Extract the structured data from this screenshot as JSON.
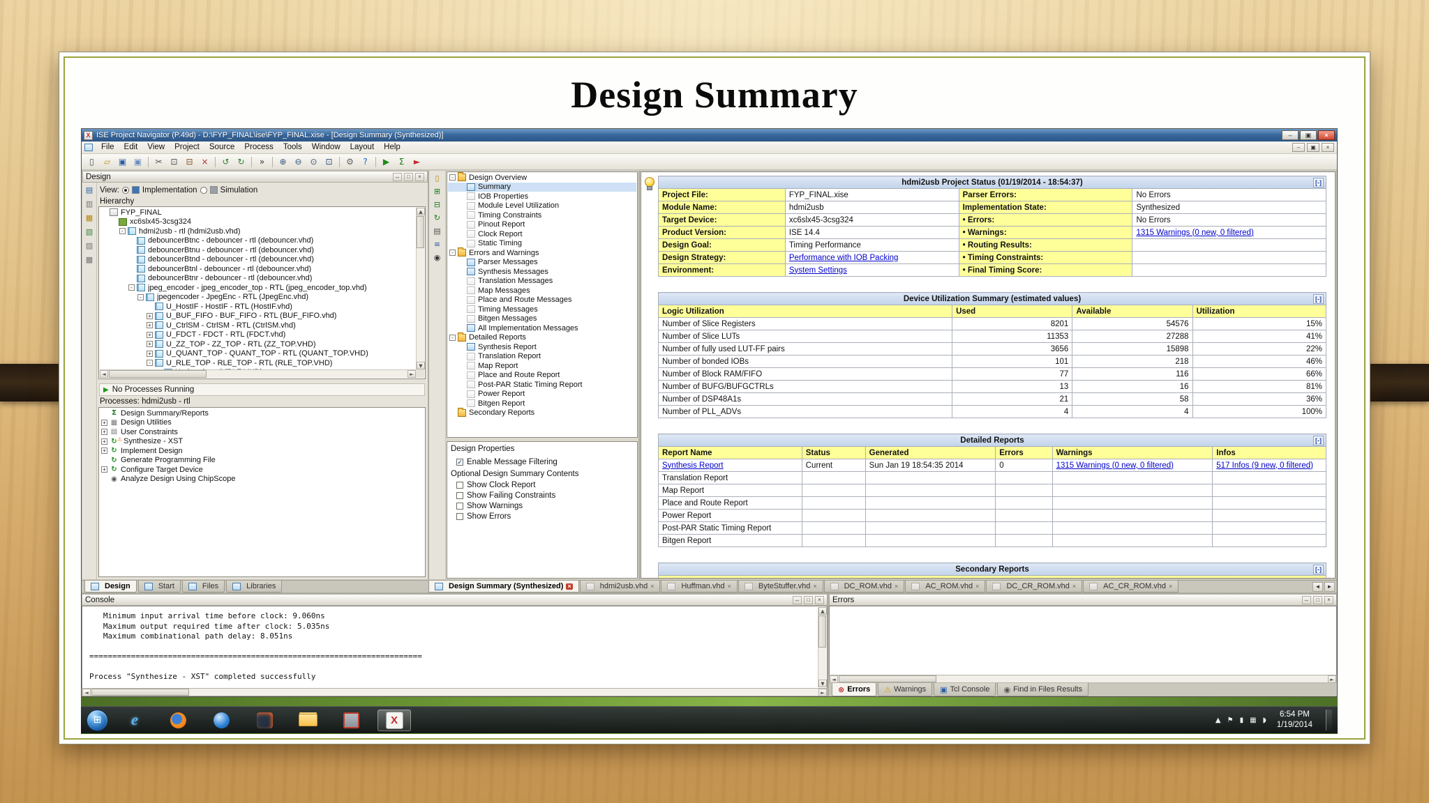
{
  "ui": {
    "minimize_box": "[-]"
  },
  "glyphs": {
    "check": "✓",
    "warning": "⚠",
    "play": "▶",
    "left": "◄",
    "right": "►",
    "up": "▲",
    "down": "▼",
    "close": "×",
    "win_flag": "⊞"
  },
  "slide": {
    "title": "Design Summary"
  },
  "titlebar": {
    "title": "ISE Project Navigator (P.49d) - D:\\FYP_FINAL\\ise\\FYP_FINAL.xise - [Design Summary (Synthesized)]",
    "controls": [
      {
        "name": "minimize-button",
        "glyph": "–"
      },
      {
        "name": "maximize-button",
        "glyph": "▣"
      },
      {
        "name": "close-button",
        "glyph": "×",
        "accent": true
      }
    ]
  },
  "menubar": {
    "items": [
      "File",
      "Edit",
      "View",
      "Project",
      "Source",
      "Process",
      "Tools",
      "Window",
      "Layout",
      "Help"
    ],
    "mdi_controls": [
      {
        "name": "mdi-minimize-button",
        "glyph": "–"
      },
      {
        "name": "mdi-restore-button",
        "glyph": "▣"
      },
      {
        "name": "mdi-close-button",
        "glyph": "×"
      }
    ]
  },
  "panel_controls": [
    {
      "name": "panel-float-button",
      "glyph": "↔"
    },
    {
      "name": "panel-restore-button",
      "glyph": "□"
    },
    {
      "name": "panel-close-button",
      "glyph": "×"
    }
  ],
  "toolbar": {
    "items": [
      {
        "name": "new-file-icon",
        "glyph": "▯",
        "color": "#4a5560"
      },
      {
        "name": "open-folder-icon",
        "glyph": "▱",
        "color": "#c09020"
      },
      {
        "name": "save-icon",
        "glyph": "▣",
        "color": "#2b5fa8"
      },
      {
        "name": "save-all-icon",
        "glyph": "▣",
        "color": "#6b8fc0"
      },
      {
        "sep": true
      },
      {
        "name": "cut-icon",
        "glyph": "✂",
        "color": "#555555"
      },
      {
        "name": "copy-icon",
        "glyph": "⊡",
        "color": "#555555"
      },
      {
        "name": "paste-icon",
        "glyph": "⊟",
        "color": "#8b5a2b"
      },
      {
        "name": "delete-icon",
        "glyph": "×",
        "color": "#b03030"
      },
      {
        "sep": true
      },
      {
        "name": "undo-icon",
        "glyph": "↺",
        "color": "#2e7d32"
      },
      {
        "name": "redo-icon",
        "glyph": "↻",
        "color": "#2e7d32"
      },
      {
        "sep": true
      },
      {
        "name": "overflow-icon",
        "glyph": "»",
        "color": "#333333"
      },
      {
        "sep": true
      },
      {
        "name": "zoom-in-icon",
        "glyph": "⊕",
        "color": "#30557f"
      },
      {
        "name": "zoom-out-icon",
        "glyph": "⊖",
        "color": "#30557f"
      },
      {
        "name": "zoom-full-icon",
        "glyph": "⊙",
        "color": "#30557f"
      },
      {
        "name": "zoom-region-icon",
        "glyph": "⊡",
        "color": "#30557f"
      },
      {
        "sep": true
      },
      {
        "name": "settings-icon",
        "glyph": "⚙",
        "color": "#666666"
      },
      {
        "name": "help-icon",
        "glyph": "?",
        "color": "#1565c0"
      },
      {
        "sep": true
      },
      {
        "name": "run-icon",
        "glyph": "▶",
        "color": "#1d8a1d"
      },
      {
        "name": "sigma-icon",
        "glyph": "Σ",
        "color": "#1d7a1d"
      },
      {
        "name": "launch-icon",
        "glyph": "►",
        "color": "#c62828"
      }
    ]
  },
  "design_panel": {
    "title": "Design",
    "strip_icons": [
      {
        "name": "sources-view-icon",
        "glyph": "▤",
        "color": "#2b5fa8"
      },
      {
        "name": "files-view-icon",
        "glyph": "▥",
        "color": "#777777"
      },
      {
        "name": "libraries-view-icon",
        "glyph": "▦",
        "color": "#b8860b"
      },
      {
        "name": "snapshots-view-icon",
        "glyph": "▧",
        "color": "#448844"
      },
      {
        "name": "console-view-icon",
        "glyph": "▨",
        "color": "#777777"
      },
      {
        "name": "reports-view-icon",
        "glyph": "▩",
        "color": "#777777"
      }
    ],
    "view_label": "View:",
    "views": [
      {
        "label": "Implementation",
        "selected": true,
        "icon_color": "#3a76b5"
      },
      {
        "label": "Simulation",
        "selected": false,
        "icon_color": "#9aa0a6"
      }
    ],
    "hierarchy_label": "Hierarchy",
    "hierarchy": [
      {
        "label": "FYP_FINAL",
        "depth": 0,
        "icon": "project"
      },
      {
        "label": "xc6slx45-3csg324",
        "depth": 1,
        "icon": "chip"
      },
      {
        "label": "hdmi2usb - rtl (hdmi2usb.vhd)",
        "depth": 2,
        "expand": "-",
        "icon": "module"
      },
      {
        "label": "debouncerBtnc - debouncer - rtl (debouncer.vhd)",
        "depth": 3,
        "icon": "module"
      },
      {
        "label": "debouncerBtnu - debouncer - rtl (debouncer.vhd)",
        "depth": 3,
        "icon": "module"
      },
      {
        "label": "debouncerBtnd - debouncer - rtl (debouncer.vhd)",
        "depth": 3,
        "icon": "module"
      },
      {
        "label": "debouncerBtnl - debouncer - rtl (debouncer.vhd)",
        "depth": 3,
        "icon": "module"
      },
      {
        "label": "debouncerBtnr - debouncer - rtl (debouncer.vhd)",
        "depth": 3,
        "icon": "module"
      },
      {
        "label": "jpeg_encoder - jpeg_encoder_top - RTL (jpeg_encoder_top.vhd)",
        "depth": 3,
        "expand": "-",
        "icon": "module"
      },
      {
        "label": "jpegencoder - JpegEnc - RTL (JpegEnc.vhd)",
        "depth": 4,
        "expand": "-",
        "icon": "module"
      },
      {
        "label": "U_HostIF - HostIF - RTL (HostIF.vhd)",
        "depth": 5,
        "icon": "module"
      },
      {
        "label": "U_BUF_FIFO - BUF_FIFO - RTL (BUF_FIFO.vhd)",
        "depth": 5,
        "expand": "+",
        "icon": "module"
      },
      {
        "label": "U_CtrlSM - CtrlSM - RTL (CtrlSM.vhd)",
        "depth": 5,
        "expand": "+",
        "icon": "module"
      },
      {
        "label": "U_FDCT - FDCT - RTL (FDCT.vhd)",
        "depth": 5,
        "expand": "+",
        "icon": "module"
      },
      {
        "label": "U_ZZ_TOP - ZZ_TOP - RTL (ZZ_TOP.VHD)",
        "depth": 5,
        "expand": "+",
        "icon": "module"
      },
      {
        "label": "U_QUANT_TOP - QUANT_TOP - RTL (QUANT_TOP.VHD)",
        "depth": 5,
        "expand": "+",
        "icon": "module"
      },
      {
        "label": "U_RLE_TOP - RLE_TOP - RTL (RLE_TOP.VHD)",
        "depth": 5,
        "expand": "-",
        "icon": "module"
      },
      {
        "label": "U_rle - rle - rtl (RLE.VHD)",
        "depth": 6,
        "icon": "module"
      }
    ],
    "no_processes": "No Processes Running",
    "processes_label": "Processes: hdmi2usb - rtl",
    "processes": [
      {
        "label": "Design Summary/Reports",
        "glyph": "Σ",
        "color": "#1d7a1d"
      },
      {
        "label": "Design Utilities",
        "expand": "+",
        "glyph": "▦",
        "color": "#777777"
      },
      {
        "label": "User Constraints",
        "expand": "+",
        "glyph": "▤",
        "color": "#777777"
      },
      {
        "label": "Synthesize - XST",
        "expand": "+",
        "glyph": "↻",
        "color": "#1d8a1d",
        "warn": true
      },
      {
        "label": "Implement Design",
        "expand": "+",
        "glyph": "↻",
        "color": "#1d8a1d"
      },
      {
        "label": "Generate Programming File",
        "glyph": "↻",
        "color": "#1d8a1d"
      },
      {
        "label": "Configure Target Device",
        "expand": "+",
        "glyph": "↻",
        "color": "#1d8a1d"
      },
      {
        "label": "Analyze Design Using ChipScope",
        "glyph": "◉",
        "color": "#555555"
      }
    ],
    "tabs": [
      {
        "label": "Design",
        "active": true
      },
      {
        "label": "Start"
      },
      {
        "label": "Files"
      },
      {
        "label": "Libraries"
      }
    ]
  },
  "overview_strip": [
    {
      "name": "new-report-icon",
      "glyph": "▯",
      "color": "#b8860b"
    },
    {
      "name": "expand-all-icon",
      "glyph": "⊞",
      "color": "#1d7a1d"
    },
    {
      "name": "collapse-all-icon",
      "glyph": "⊟",
      "color": "#1d7a1d"
    },
    {
      "name": "refresh-icon",
      "glyph": "↻",
      "color": "#1d7a1d"
    },
    {
      "name": "print-icon",
      "glyph": "▤",
      "color": "#555555"
    },
    {
      "name": "options-icon",
      "glyph": "≡",
      "color": "#2b5fa8"
    },
    {
      "name": "find-icon",
      "glyph": "◉",
      "color": "#333333"
    }
  ],
  "design_overview": {
    "tree": [
      {
        "label": "Design Overview",
        "depth": 0,
        "expand": "-",
        "icon": "folder"
      },
      {
        "label": "Summary",
        "depth": 1,
        "icon": "page",
        "on": true,
        "selected": true
      },
      {
        "label": "IOB Properties",
        "depth": 1,
        "icon": "page"
      },
      {
        "label": "Module Level Utilization",
        "depth": 1,
        "icon": "page"
      },
      {
        "label": "Timing Constraints",
        "depth": 1,
        "icon": "page"
      },
      {
        "label": "Pinout Report",
        "depth": 1,
        "icon": "page"
      },
      {
        "label": "Clock Report",
        "depth": 1,
        "icon": "page"
      },
      {
        "label": "Static Timing",
        "depth": 1,
        "icon": "page"
      },
      {
        "label": "Errors and Warnings",
        "depth": 0,
        "expand": "-",
        "icon": "folder"
      },
      {
        "label": "Parser Messages",
        "depth": 1,
        "icon": "page",
        "on": true
      },
      {
        "label": "Synthesis Messages",
        "depth": 1,
        "icon": "page",
        "on": true
      },
      {
        "label": "Translation Messages",
        "depth": 1,
        "icon": "page"
      },
      {
        "label": "Map Messages",
        "depth": 1,
        "icon": "page"
      },
      {
        "label": "Place and Route Messages",
        "depth": 1,
        "icon": "page"
      },
      {
        "label": "Timing Messages",
        "depth": 1,
        "icon": "page"
      },
      {
        "label": "Bitgen Messages",
        "depth": 1,
        "icon": "page"
      },
      {
        "label": "All Implementation Messages",
        "depth": 1,
        "icon": "page",
        "on": true
      },
      {
        "label": "Detailed Reports",
        "depth": 0,
        "expand": "-",
        "icon": "folder"
      },
      {
        "label": "Synthesis Report",
        "depth": 1,
        "icon": "page",
        "on": true
      },
      {
        "label": "Translation Report",
        "depth": 1,
        "icon": "page"
      },
      {
        "label": "Map Report",
        "depth": 1,
        "icon": "page"
      },
      {
        "label": "Place and Route Report",
        "depth": 1,
        "icon": "page"
      },
      {
        "label": "Post-PAR Static Timing Report",
        "depth": 1,
        "icon": "page"
      },
      {
        "label": "Power Report",
        "depth": 1,
        "icon": "page"
      },
      {
        "label": "Bitgen Report",
        "depth": 1,
        "icon": "page"
      },
      {
        "label": "Secondary Reports",
        "depth": 0,
        "icon": "folder"
      }
    ]
  },
  "design_properties": {
    "title": "Design Properties",
    "items": [
      {
        "label": "Enable Message Filtering",
        "checked": true
      }
    ],
    "section_label": "Optional Design Summary Contents",
    "options": [
      {
        "label": "Show Clock Report",
        "checked": false
      },
      {
        "label": "Show Failing Constraints",
        "checked": false
      },
      {
        "label": "Show Warnings",
        "checked": false
      },
      {
        "label": "Show Errors",
        "checked": false
      }
    ]
  },
  "project_status": {
    "title": "hdmi2usb Project Status (01/19/2014 - 18:54:37)",
    "rows": [
      {
        "l1": "Project File:",
        "v1": {
          "text": "FYP_FINAL.xise"
        },
        "l2": "Parser Errors:",
        "v2": {
          "text": "No Errors"
        }
      },
      {
        "l1": "Module Name:",
        "v1": {
          "text": "hdmi2usb"
        },
        "l2": "Implementation State:",
        "v2": {
          "text": "Synthesized"
        }
      },
      {
        "l1": "Target Device:",
        "v1": {
          "text": "xc6slx45-3csg324"
        },
        "l2": "• Errors:",
        "v2": {
          "text": "No Errors"
        }
      },
      {
        "l1": "Product Version:",
        "v1": {
          "text": "ISE 14.4"
        },
        "l2": "• Warnings:",
        "v2": {
          "text": "1315 Warnings (0 new, 0 filtered)",
          "link": true
        }
      },
      {
        "l1": "Design Goal:",
        "v1": {
          "text": "Timing Performance"
        },
        "l2": "• Routing Results:",
        "v2": {
          "text": ""
        }
      },
      {
        "l1": "Design Strategy:",
        "v1": {
          "text": "Performance with IOB Packing",
          "link": true
        },
        "l2": "• Timing Constraints:",
        "v2": {
          "text": ""
        }
      },
      {
        "l1": "Environment:",
        "v1": {
          "text": "System Settings",
          "link": true
        },
        "l2": "• Final Timing Score:",
        "v2": {
          "text": ""
        }
      }
    ]
  },
  "device_utilization": {
    "title": "Device Utilization Summary (estimated values)",
    "headers": [
      "Logic Utilization",
      "Used",
      "Available",
      "Utilization"
    ],
    "rows": [
      [
        "Number of Slice Registers",
        "8201",
        "54576",
        "15%"
      ],
      [
        "Number of Slice LUTs",
        "11353",
        "27288",
        "41%"
      ],
      [
        "Number of fully used LUT-FF pairs",
        "3656",
        "15898",
        "22%"
      ],
      [
        "Number of bonded IOBs",
        "101",
        "218",
        "46%"
      ],
      [
        "Number of Block RAM/FIFO",
        "77",
        "116",
        "66%"
      ],
      [
        "Number of BUFG/BUFGCTRLs",
        "13",
        "16",
        "81%"
      ],
      [
        "Number of DSP48A1s",
        "21",
        "58",
        "36%"
      ],
      [
        "Number of PLL_ADVs",
        "4",
        "4",
        "100%"
      ]
    ]
  },
  "detailed_reports": {
    "title": "Detailed Reports",
    "headers": [
      "Report Name",
      "Status",
      "Generated",
      "Errors",
      "Warnings",
      "Infos"
    ],
    "rows": [
      {
        "name": {
          "text": "Synthesis Report",
          "link": true
        },
        "status": "Current",
        "generated": "Sun Jan 19 18:54:35 2014",
        "errors": "0",
        "warnings": {
          "text": "1315 Warnings (0 new, 0 filtered)",
          "link": true
        },
        "infos": {
          "text": "517 Infos (9 new, 0 filtered)",
          "link": true
        }
      },
      {
        "name": {
          "text": "Translation Report"
        }
      },
      {
        "name": {
          "text": "Map Report"
        }
      },
      {
        "name": {
          "text": "Place and Route Report"
        }
      },
      {
        "name": {
          "text": "Power Report"
        }
      },
      {
        "name": {
          "text": "Post-PAR Static Timing Report"
        }
      },
      {
        "name": {
          "text": "Bitgen Report"
        }
      }
    ]
  },
  "secondary_reports": {
    "title": "Secondary Reports"
  },
  "doc_tabs": [
    {
      "label": "Design Summary (Synthesized)",
      "active": true
    },
    {
      "label": "hdmi2usb.vhd"
    },
    {
      "label": "Huffman.vhd"
    },
    {
      "label": "ByteStuffer.vhd"
    },
    {
      "label": "DC_ROM.vhd"
    },
    {
      "label": "AC_ROM.vhd"
    },
    {
      "label": "DC_CR_ROM.vhd"
    },
    {
      "label": "AC_CR_ROM.vhd"
    }
  ],
  "tab_scroll": [
    {
      "name": "tabs-scroll-left-button",
      "glyph": "◄"
    },
    {
      "name": "tabs-scroll-right-button",
      "glyph": "►"
    }
  ],
  "console": {
    "title": "Console",
    "lines": [
      "   Minimum input arrival time before clock: 9.060ns",
      "   Maximum output required time after clock: 5.035ns",
      "   Maximum combinational path delay: 8.051ns",
      "",
      "========================================================================",
      "",
      "Process \"Synthesize - XST\" completed successfully"
    ]
  },
  "errors_panel": {
    "title": "Errors"
  },
  "status_tabs": [
    {
      "label": "Errors",
      "glyph": "⊗",
      "color": "#c43030",
      "active": true
    },
    {
      "label": "Warnings",
      "glyph": "⚠",
      "color": "#e0a000"
    },
    {
      "label": "Tcl Console",
      "glyph": "▣",
      "color": "#2b5fa8"
    },
    {
      "label": "Find in Files Results",
      "glyph": "◉",
      "color": "#555555"
    }
  ],
  "taskbar": {
    "icons": [
      {
        "name": "internet-explorer-icon",
        "kind": "ie"
      },
      {
        "name": "firefox-icon",
        "kind": "ff"
      },
      {
        "name": "media-player-icon",
        "kind": "mp"
      },
      {
        "name": "matlab-icon",
        "kind": "ml"
      },
      {
        "name": "file-explorer-icon",
        "kind": "ex"
      },
      {
        "name": "editor-icon",
        "kind": "ps"
      },
      {
        "name": "ise-icon",
        "kind": "ise",
        "active": true
      }
    ],
    "tray": [
      {
        "name": "tray-expand-icon",
        "glyph": "▲"
      },
      {
        "name": "action-center-icon",
        "glyph": "⚑"
      },
      {
        "name": "power-icon",
        "glyph": "▮"
      },
      {
        "name": "network-icon",
        "glyph": "▦"
      },
      {
        "name": "volume-icon",
        "glyph": "◗"
      }
    ],
    "clock_time": "6:54 PM",
    "clock_date": "1/19/2014"
  }
}
